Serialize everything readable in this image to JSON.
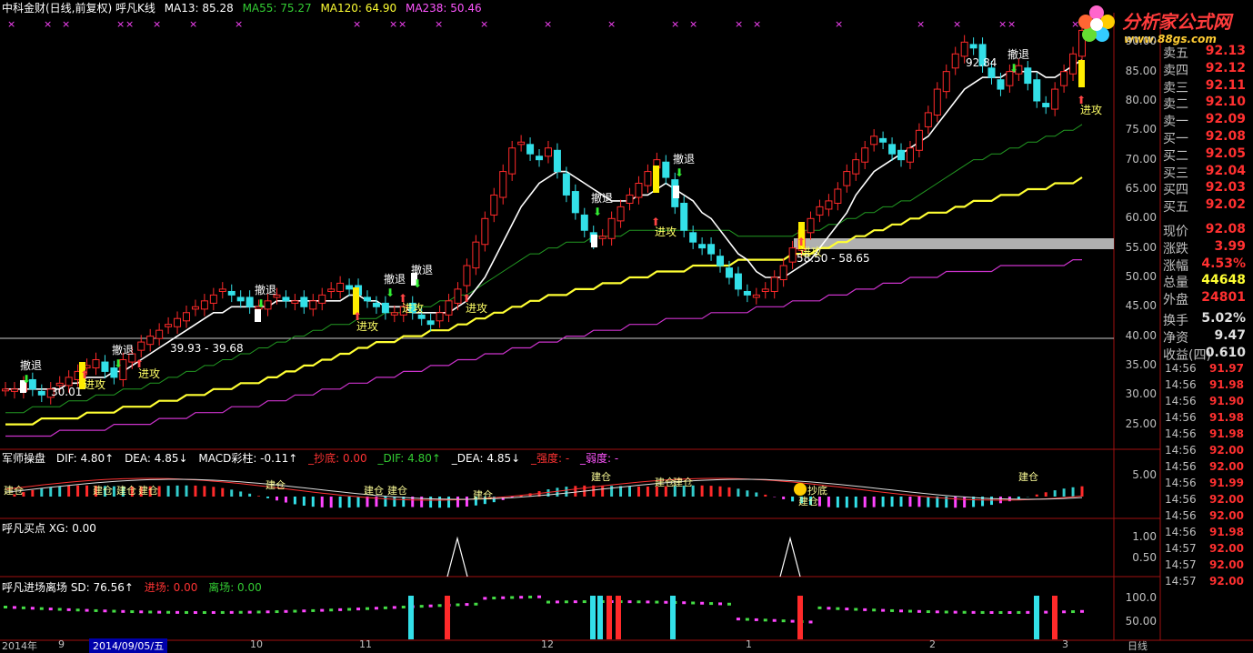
{
  "header": {
    "title": "中科金财(日线,前复权) 呼凡K线",
    "ma": [
      {
        "label": "MA13: 85.28",
        "color": "#ffffff"
      },
      {
        "label": "MA55: 75.27",
        "color": "#33cc33"
      },
      {
        "label": "MA120: 64.90",
        "color": "#ffff33"
      },
      {
        "label": "MA238: 50.46",
        "color": "#ff55ff"
      }
    ]
  },
  "logo": {
    "name": "分析家公式网",
    "url": "www.88gs.com"
  },
  "price_axis": [
    "90.00",
    "85.00",
    "80.00",
    "75.00",
    "70.00",
    "65.00",
    "60.00",
    "55.00",
    "50.00",
    "45.00",
    "40.00",
    "35.00",
    "30.00",
    "25.00"
  ],
  "chart_annotations": {
    "high_label": "92.84",
    "low_label": "30.01",
    "range1": "39.93 - 39.68",
    "range2": "58.50 - 58.65"
  },
  "panels": {
    "macd": {
      "items": [
        {
          "label": "军师操盘",
          "color": "#ffffff"
        },
        {
          "label": "DIF: 4.80↑",
          "color": "#ffffff"
        },
        {
          "label": "DEA: 4.85↓",
          "color": "#ffffff"
        },
        {
          "label": "MACD彩柱: -0.11↑",
          "color": "#ffffff"
        },
        {
          "label": "_抄底: 0.00",
          "color": "#ff3333"
        },
        {
          "label": "_DIF: 4.80↑",
          "color": "#33cc33"
        },
        {
          "label": "_DEA: 4.85↓",
          "color": "#ffffff"
        },
        {
          "label": "_强度: -",
          "color": "#ff3333"
        },
        {
          "label": "_弱度: -",
          "color": "#ff55ff"
        }
      ],
      "axis": [
        "5.00"
      ]
    },
    "buy": {
      "items": [
        {
          "label": "呼凡买点 XG: 0.00",
          "color": "#ffffff"
        }
      ],
      "axis": [
        "1.00",
        "0.50"
      ]
    },
    "entry": {
      "items": [
        {
          "label": "呼凡进场离场 SD: 76.56↑",
          "color": "#ffffff"
        },
        {
          "label": "进场: 0.00",
          "color": "#ff3333"
        },
        {
          "label": "离场: 0.00",
          "color": "#33cc33"
        }
      ],
      "axis": [
        "100.0",
        "50.00"
      ]
    }
  },
  "quote": [
    {
      "k": "卖五",
      "v": "92.13",
      "color": "#ff3030"
    },
    {
      "k": "卖四",
      "v": "92.12",
      "color": "#ff3030"
    },
    {
      "k": "卖三",
      "v": "92.11",
      "color": "#ff3030"
    },
    {
      "k": "卖二",
      "v": "92.10",
      "color": "#ff3030"
    },
    {
      "k": "卖一",
      "v": "92.09",
      "color": "#ff3030"
    },
    {
      "k": "买一",
      "v": "92.08",
      "color": "#ff3030"
    },
    {
      "k": "买二",
      "v": "92.05",
      "color": "#ff3030"
    },
    {
      "k": "买三",
      "v": "92.04",
      "color": "#ff3030"
    },
    {
      "k": "买四",
      "v": "92.03",
      "color": "#ff3030"
    },
    {
      "k": "买五",
      "v": "92.02",
      "color": "#ff3030"
    },
    {
      "k": "现价",
      "v": "92.08",
      "color": "#ff3030"
    },
    {
      "k": "涨跌",
      "v": "3.99",
      "color": "#ff3030"
    },
    {
      "k": "涨幅",
      "v": "4.53%",
      "color": "#ff3030"
    },
    {
      "k": "总量",
      "v": "44648",
      "color": "#ffff33"
    },
    {
      "k": "外盘",
      "v": "24801",
      "color": "#ff3030"
    },
    {
      "k": "换手",
      "v": "5.02%",
      "color": "#e0e0e0"
    },
    {
      "k": "净资",
      "v": "9.47",
      "color": "#e0e0e0"
    },
    {
      "k": "收益(四)",
      "v": "0.610",
      "color": "#e0e0e0"
    }
  ],
  "ticks": [
    {
      "t": "14:56",
      "p": "91.97"
    },
    {
      "t": "14:56",
      "p": "91.98"
    },
    {
      "t": "14:56",
      "p": "91.90"
    },
    {
      "t": "14:56",
      "p": "91.98"
    },
    {
      "t": "14:56",
      "p": "91.98"
    },
    {
      "t": "14:56",
      "p": "92.00"
    },
    {
      "t": "14:56",
      "p": "92.00"
    },
    {
      "t": "14:56",
      "p": "91.99"
    },
    {
      "t": "14:56",
      "p": "92.00"
    },
    {
      "t": "14:56",
      "p": "92.00"
    },
    {
      "t": "14:56",
      "p": "91.98"
    },
    {
      "t": "14:57",
      "p": "92.00"
    },
    {
      "t": "14:57",
      "p": "92.00"
    },
    {
      "t": "14:57",
      "p": "92.00"
    }
  ],
  "labels": {
    "attack": "进攻",
    "retreat": "撤退",
    "build": "建仓",
    "bottom": "抄底"
  },
  "datebar": {
    "selected": "2014/09/05/五",
    "months": [
      "2014年",
      "9",
      "10",
      "11",
      "12",
      "1",
      "2",
      "3"
    ],
    "mode": "日线"
  },
  "chart_data": {
    "type": "candlestick",
    "y_range": [
      22,
      95
    ],
    "close_series": [
      31,
      31,
      32,
      31,
      30,
      31,
      32,
      33,
      34,
      35,
      36,
      34,
      33,
      36,
      37,
      39,
      40,
      41,
      42,
      43,
      44,
      45,
      46,
      47,
      48,
      47,
      46,
      45,
      45,
      46,
      47,
      46,
      46,
      45,
      46,
      47,
      48,
      49,
      48,
      47,
      46,
      45,
      44,
      44,
      45,
      44,
      43,
      42,
      44,
      46,
      48,
      52,
      56,
      60,
      64,
      68,
      72,
      73,
      71,
      70,
      72,
      68,
      64,
      61,
      58,
      56,
      57,
      60,
      62,
      64,
      66,
      68,
      70,
      67,
      62,
      58,
      56,
      55,
      54,
      52,
      50,
      48,
      47,
      47,
      48,
      50,
      52,
      55,
      58,
      60,
      62,
      63,
      65,
      68,
      70,
      72,
      74,
      73,
      71,
      70,
      72,
      75,
      78,
      82,
      85,
      88,
      90,
      89,
      86,
      84,
      82,
      85,
      86,
      83,
      80,
      79,
      82,
      85,
      88,
      92
    ],
    "ma13": [
      31,
      31,
      31,
      31,
      31,
      31,
      31,
      32,
      32,
      33,
      33,
      33,
      34,
      34,
      35,
      36,
      37,
      38,
      39,
      40,
      41,
      42,
      43,
      44,
      44,
      45,
      45,
      45,
      45,
      45,
      46,
      46,
      46,
      46,
      46,
      46,
      46,
      46,
      47,
      47,
      46,
      46,
      45,
      45,
      45,
      44,
      44,
      44,
      44,
      44,
      45,
      46,
      48,
      50,
      53,
      56,
      59,
      62,
      64,
      66,
      67,
      68,
      68,
      67,
      66,
      65,
      64,
      63,
      63,
      63,
      64,
      64,
      65,
      66,
      65,
      64,
      63,
      61,
      60,
      58,
      56,
      54,
      53,
      51,
      50,
      50,
      50,
      51,
      52,
      53,
      55,
      57,
      59,
      61,
      64,
      66,
      68,
      69,
      70,
      71,
      72,
      73,
      74,
      76,
      78,
      80,
      82,
      83,
      84,
      84,
      84,
      85,
      85,
      85,
      85,
      84,
      84,
      85,
      86,
      87
    ],
    "ma55": [
      27,
      27,
      27,
      28,
      28,
      28,
      28,
      29,
      29,
      29,
      30,
      30,
      30,
      31,
      31,
      31,
      32,
      32,
      33,
      33,
      34,
      34,
      35,
      35,
      36,
      36,
      37,
      37,
      38,
      38,
      39,
      39,
      40,
      40,
      41,
      41,
      42,
      42,
      42,
      43,
      43,
      43,
      44,
      44,
      44,
      45,
      45,
      45,
      46,
      46,
      47,
      47,
      48,
      49,
      50,
      51,
      52,
      53,
      54,
      54,
      55,
      55,
      56,
      56,
      56,
      57,
      57,
      57,
      57,
      58,
      58,
      58,
      58,
      58,
      58,
      58,
      58,
      58,
      58,
      58,
      58,
      57,
      57,
      57,
      57,
      57,
      57,
      57,
      58,
      58,
      58,
      59,
      59,
      60,
      60,
      61,
      61,
      62,
      62,
      63,
      63,
      64,
      65,
      66,
      67,
      68,
      69,
      70,
      70,
      71,
      71,
      72,
      72,
      73,
      73,
      74,
      74,
      75,
      75,
      76
    ],
    "ma120": [
      25,
      25,
      25,
      25,
      26,
      26,
      26,
      26,
      26,
      27,
      27,
      27,
      27,
      28,
      28,
      28,
      28,
      29,
      29,
      29,
      30,
      30,
      30,
      31,
      31,
      31,
      32,
      32,
      32,
      33,
      33,
      34,
      34,
      35,
      35,
      36,
      36,
      37,
      37,
      38,
      38,
      39,
      39,
      39,
      40,
      40,
      40,
      41,
      41,
      41,
      42,
      42,
      43,
      43,
      44,
      44,
      45,
      45,
      46,
      46,
      47,
      47,
      47,
      48,
      48,
      48,
      49,
      49,
      49,
      50,
      50,
      50,
      51,
      51,
      51,
      51,
      52,
      52,
      52,
      52,
      52,
      53,
      53,
      53,
      53,
      53,
      53,
      54,
      54,
      54,
      55,
      55,
      56,
      56,
      57,
      57,
      58,
      58,
      59,
      59,
      60,
      60,
      61,
      61,
      61,
      62,
      62,
      63,
      63,
      63,
      64,
      64,
      64,
      65,
      65,
      65,
      66,
      66,
      66,
      67
    ],
    "ma238": [
      23,
      23,
      23,
      23,
      23,
      23,
      24,
      24,
      24,
      24,
      24,
      24,
      25,
      25,
      25,
      25,
      25,
      26,
      26,
      26,
      26,
      27,
      27,
      27,
      27,
      28,
      28,
      28,
      28,
      29,
      29,
      29,
      30,
      30,
      30,
      31,
      31,
      31,
      32,
      32,
      32,
      33,
      33,
      33,
      34,
      34,
      34,
      35,
      35,
      35,
      36,
      36,
      36,
      37,
      37,
      37,
      38,
      38,
      38,
      39,
      39,
      39,
      40,
      40,
      40,
      41,
      41,
      41,
      41,
      42,
      42,
      42,
      42,
      43,
      43,
      43,
      43,
      43,
      44,
      44,
      44,
      44,
      44,
      45,
      45,
      45,
      45,
      46,
      46,
      46,
      46,
      47,
      47,
      47,
      48,
      48,
      48,
      49,
      49,
      49,
      50,
      50,
      50,
      50,
      51,
      51,
      51,
      51,
      51,
      51,
      52,
      52,
      52,
      52,
      52,
      52,
      52,
      52,
      53,
      53
    ]
  }
}
